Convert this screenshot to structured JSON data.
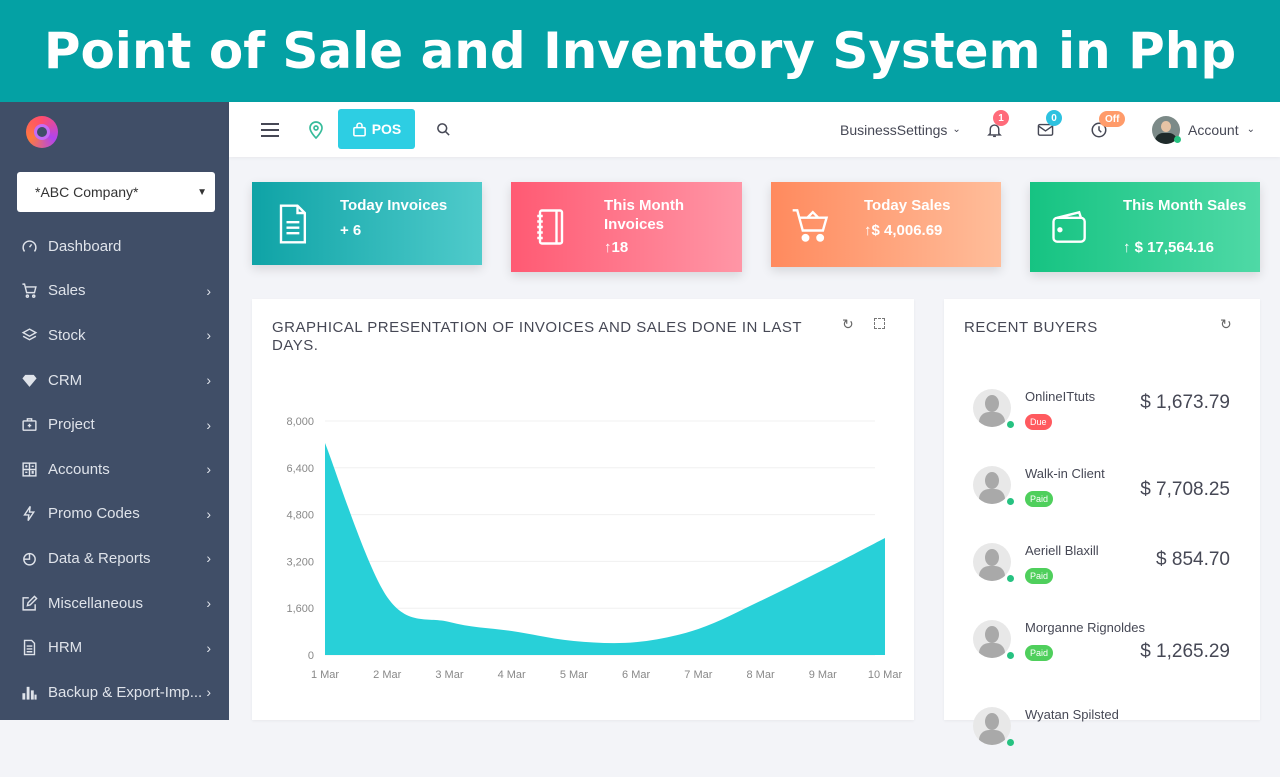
{
  "banner": {
    "title": "Point of Sale and Inventory System in Php"
  },
  "sidebar": {
    "company_select": "*ABC Company*",
    "items": [
      {
        "label": "Dashboard",
        "icon": "speedometer-icon",
        "has_submenu": false
      },
      {
        "label": "Sales",
        "icon": "cart-icon",
        "has_submenu": true
      },
      {
        "label": "Stock",
        "icon": "layers-icon",
        "has_submenu": true
      },
      {
        "label": "CRM",
        "icon": "diamond-icon",
        "has_submenu": true
      },
      {
        "label": "Project",
        "icon": "briefcase-icon",
        "has_submenu": true
      },
      {
        "label": "Accounts",
        "icon": "calculator-icon",
        "has_submenu": true
      },
      {
        "label": "Promo Codes",
        "icon": "bolt-icon",
        "has_submenu": true
      },
      {
        "label": "Data & Reports",
        "icon": "pie-chart-icon",
        "has_submenu": true
      },
      {
        "label": "Miscellaneous",
        "icon": "edit-icon",
        "has_submenu": true
      },
      {
        "label": "HRM",
        "icon": "document-icon",
        "has_submenu": true
      },
      {
        "label": "Backup & Export-Imp...",
        "icon": "bar-chart-icon",
        "has_submenu": true
      }
    ]
  },
  "topbar": {
    "pos_label": "POS",
    "business_settings": "BusinessSettings",
    "notifications_count": "1",
    "messages_count": "0",
    "clock_status": "Off",
    "account_label": "Account"
  },
  "cards": [
    {
      "title": "Today Invoices",
      "value": "+ 6",
      "color_start": "#0fa3a6",
      "color_end": "#4fcbcb"
    },
    {
      "title": "This Month Invoices",
      "value": "↑18",
      "color_start": "#ff5a73",
      "color_end": "#ff96a6"
    },
    {
      "title": "Today Sales",
      "value": "↑$ 4,006.69",
      "color_start": "#ff8a5e",
      "color_end": "#ffbd9a"
    },
    {
      "title": "This Month Sales",
      "value": "↑ $ 17,564.16",
      "color_start": "#16c382",
      "color_end": "#4fd9a6"
    }
  ],
  "chart_panel": {
    "title": "GRAPHICAL PRESENTATION OF INVOICES AND SALES DONE IN LAST DAYS."
  },
  "chart_data": {
    "type": "area",
    "title": "GRAPHICAL PRESENTATION OF INVOICES AND SALES DONE IN LAST DAYS.",
    "categories": [
      "1 Mar",
      "2 Mar",
      "3 Mar",
      "4 Mar",
      "5 Mar",
      "6 Mar",
      "7 Mar",
      "8 Mar",
      "9 Mar",
      "10 Mar"
    ],
    "values": [
      7250,
      1980,
      1130,
      820,
      480,
      440,
      890,
      1850,
      2900,
      4000
    ],
    "yticks": [
      0,
      1600,
      3200,
      4800,
      6400,
      8000
    ],
    "ytick_labels": [
      "0",
      "1,600",
      "3,200",
      "4,800",
      "6,400",
      "8,000"
    ],
    "ylim": [
      0,
      8000
    ],
    "xlabel": "",
    "ylabel": "",
    "grid": true,
    "color": "#28d0d8"
  },
  "recent_buyers": {
    "title": "RECENT BUYERS",
    "buyers": [
      {
        "name": "OnlineITtuts",
        "status": "Due",
        "amount": "$ 1,673.79"
      },
      {
        "name": "Walk-in Client",
        "status": "Paid",
        "amount": "$ 7,708.25"
      },
      {
        "name": "Aeriell Blaxill",
        "status": "Paid",
        "amount": "$ 854.70"
      },
      {
        "name": "Morganne Rignoldes",
        "status": "Paid",
        "amount": "$ 1,265.29"
      },
      {
        "name": "Wyatan Spilsted",
        "status": "",
        "amount": ""
      }
    ],
    "status_colors": {
      "Due": "#ff5a5f",
      "Paid": "#4fcf5c"
    }
  }
}
